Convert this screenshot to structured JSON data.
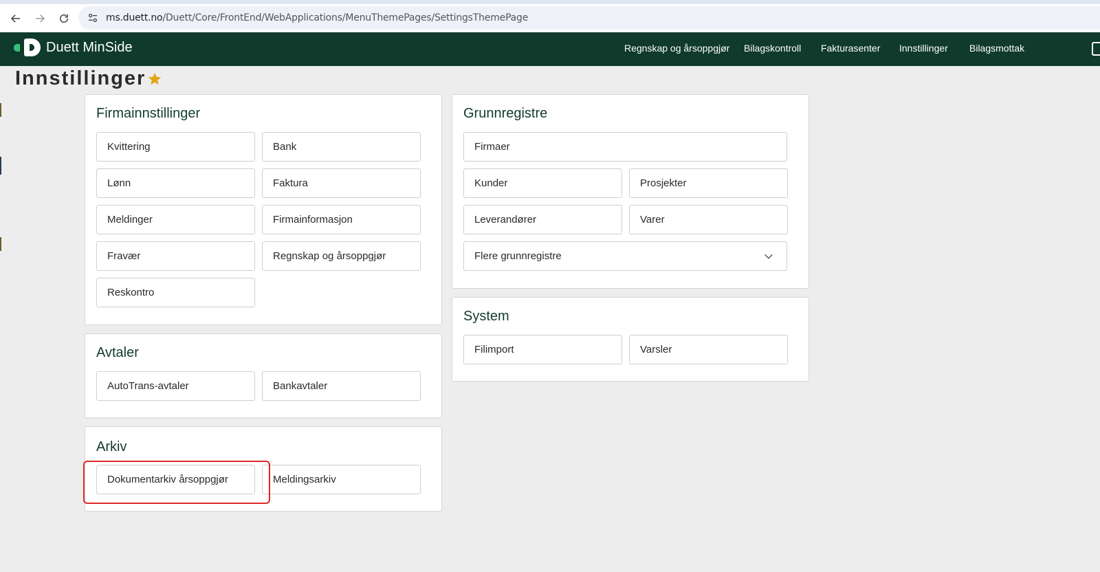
{
  "browser": {
    "url_host": "ms.duett.no",
    "url_path": "/Duett/Core/FrontEnd/WebApplications/MenuThemePages/SettingsThemePage"
  },
  "header": {
    "logo_text": "Duett MinSide",
    "nav": [
      "Regnskap og årsoppgjør",
      "Bilagskontroll",
      "Fakturasenter",
      "Innstillinger",
      "Bilagsmottak"
    ]
  },
  "page": {
    "title": "Innstillinger"
  },
  "sections": {
    "firmainnstillinger": {
      "title": "Firmainnstillinger",
      "items": [
        "Kvittering",
        "Bank",
        "Lønn",
        "Faktura",
        "Meldinger",
        "Firmainformasjon",
        "Fravær",
        "Regnskap og årsoppgjør",
        "Reskontro"
      ]
    },
    "avtaler": {
      "title": "Avtaler",
      "items": [
        "AutoTrans-avtaler",
        "Bankavtaler"
      ]
    },
    "arkiv": {
      "title": "Arkiv",
      "items": [
        "Dokumentarkiv årsoppgjør",
        "Meldingsarkiv"
      ]
    },
    "grunnregistre": {
      "title": "Grunnregistre",
      "items": [
        "Firmaer",
        "Kunder",
        "Prosjekter",
        "Leverandører",
        "Varer"
      ],
      "dropdown_label": "Flere grunnregistre"
    },
    "system": {
      "title": "System",
      "items": [
        "Filimport",
        "Varsler"
      ]
    }
  },
  "colors": {
    "header_bg": "#0f3a2c",
    "accent_green": "#34c17a",
    "star": "#e2a614",
    "highlight": "#e02828"
  }
}
